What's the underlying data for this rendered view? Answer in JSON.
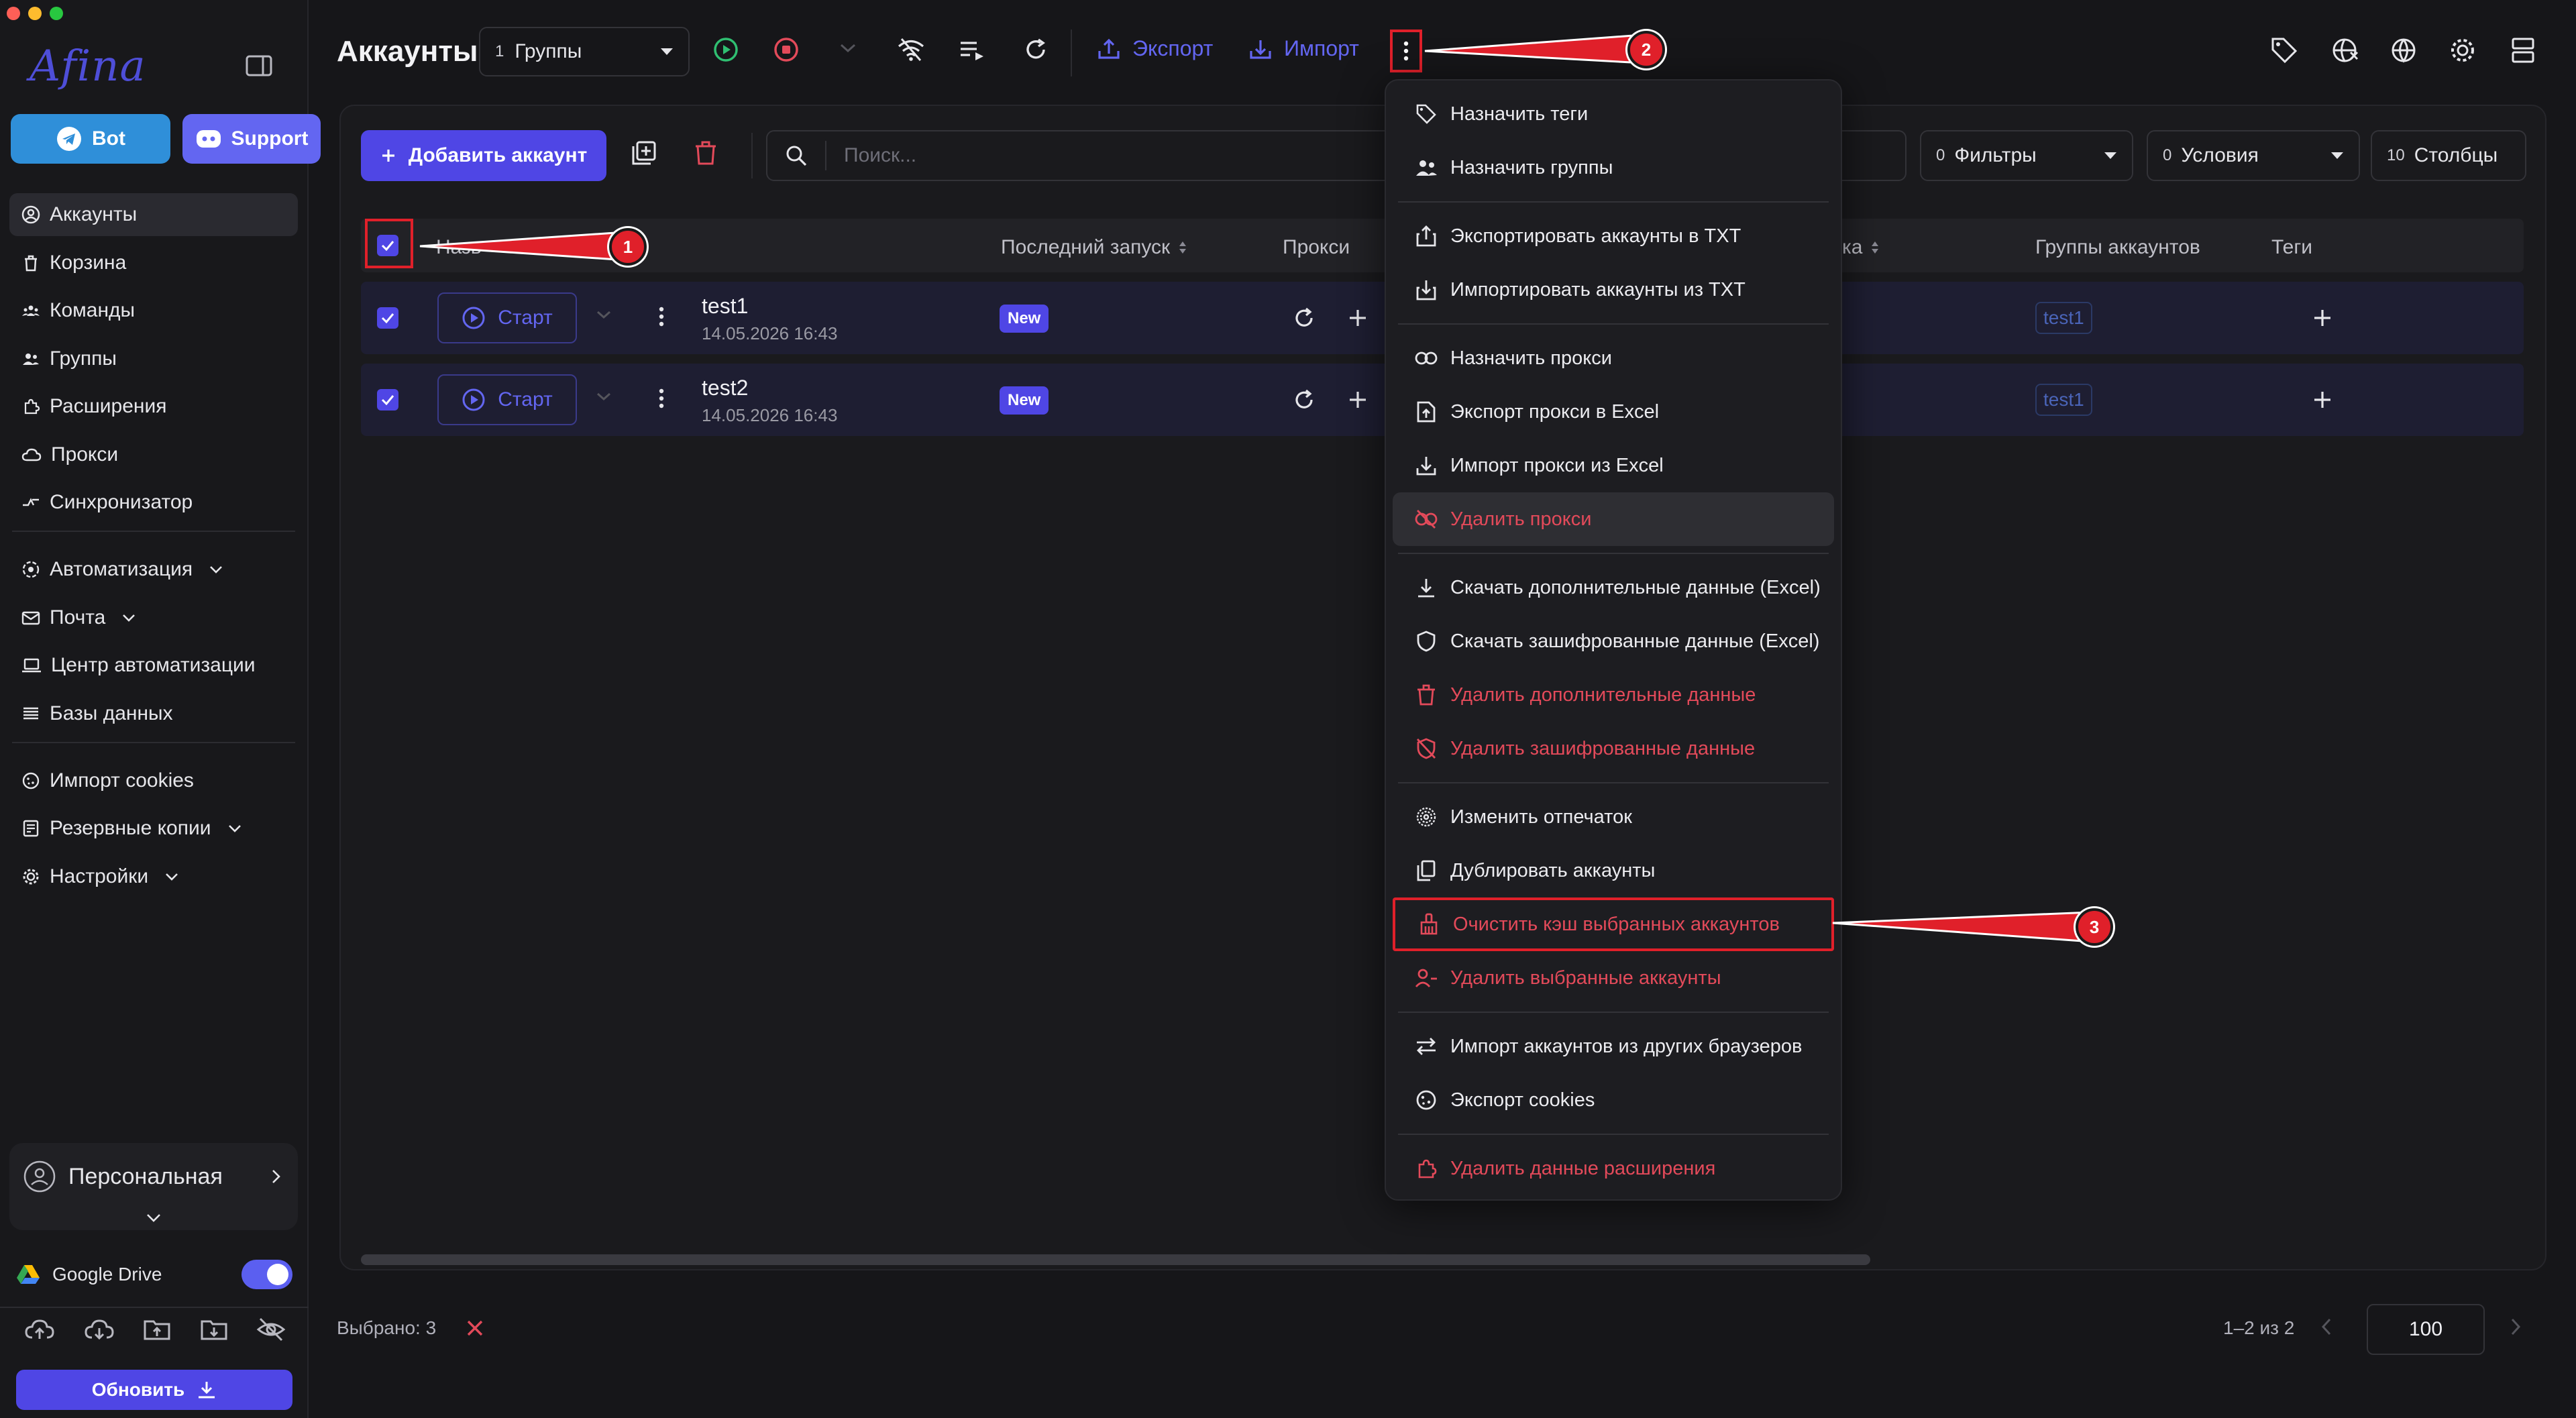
{
  "app": {
    "logo": "Afina"
  },
  "sidebar": {
    "bot_label": "Bot",
    "support_label": "Support",
    "items": [
      {
        "label": "Аккаунты",
        "icon": "user-circle-icon",
        "active": true
      },
      {
        "label": "Корзина",
        "icon": "trash-icon"
      },
      {
        "label": "Команды",
        "icon": "team-icon"
      },
      {
        "label": "Группы",
        "icon": "users-icon"
      },
      {
        "label": "Расширения",
        "icon": "puzzle-icon"
      },
      {
        "label": "Прокси",
        "icon": "cloud-icon"
      },
      {
        "label": "Синхронизатор",
        "icon": "sync-icon"
      }
    ],
    "items2": [
      {
        "label": "Автоматизация",
        "icon": "automation-icon",
        "chevron": true
      },
      {
        "label": "Почта",
        "icon": "mail-icon",
        "chevron": true
      },
      {
        "label": "Центр автоматизации",
        "icon": "laptop-icon"
      },
      {
        "label": "Базы данных",
        "icon": "list-icon"
      }
    ],
    "items3": [
      {
        "label": "Импорт cookies",
        "icon": "cookie-icon"
      },
      {
        "label": "Резервные копии",
        "icon": "backup-icon",
        "chevron": true
      },
      {
        "label": "Настройки",
        "icon": "gear-icon",
        "chevron": true
      }
    ],
    "workspace_label": "Персональная",
    "gdrive_label": "Google Drive",
    "update_label": "Обновить"
  },
  "toolbar": {
    "title": "Аккаунты",
    "group_count": "1",
    "group_label": "Группы",
    "export_label": "Экспорт",
    "import_label": "Импорт"
  },
  "content": {
    "add_account_label": "Добавить аккаунт",
    "search_placeholder": "Поиск...",
    "filters_count": "0",
    "filters_label": "Фильтры",
    "conditions_count": "0",
    "conditions_label": "Условия",
    "columns_count": "10",
    "columns_label": "Столбцы"
  },
  "table": {
    "headers": {
      "name": "Назв",
      "last_launch": "Последний запуск",
      "proxy": "Прокси",
      "partial": "ка",
      "groups": "Группы аккаунтов",
      "tags": "Теги"
    },
    "rows": [
      {
        "start_label": "Старт",
        "name": "test1",
        "date": "14.05.2026 16:43",
        "status": "New",
        "group": "test1"
      },
      {
        "start_label": "Старт",
        "name": "test2",
        "date": "14.05.2026 16:43",
        "status": "New",
        "group": "test1"
      }
    ]
  },
  "footer": {
    "selected_label": "Выбрано: 3",
    "pagination": "1–2 из 2",
    "page_size": "100"
  },
  "menu": {
    "sections": [
      [
        {
          "label": "Назначить теги",
          "icon": "tag-icon"
        },
        {
          "label": "Назначить группы",
          "icon": "users-icon"
        }
      ],
      [
        {
          "label": "Экспортировать аккаунты в TXT",
          "icon": "export-icon"
        },
        {
          "label": "Импортировать аккаунты из TXT",
          "icon": "import-icon"
        }
      ],
      [
        {
          "label": "Назначить прокси",
          "icon": "link-icon"
        },
        {
          "label": "Экспорт прокси в Excel",
          "icon": "file-upload-icon"
        },
        {
          "label": "Импорт прокси из Excel",
          "icon": "download-icon"
        },
        {
          "label": "Удалить прокси",
          "icon": "unlink-icon",
          "danger": true,
          "hover": true
        }
      ],
      [
        {
          "label": "Скачать дополнительные данные (Excel)",
          "icon": "download-bar-icon"
        },
        {
          "label": "Скачать зашифрованные данные (Excel)",
          "icon": "shield-icon"
        },
        {
          "label": "Удалить дополнительные данные",
          "icon": "trash-icon",
          "danger": true
        },
        {
          "label": "Удалить зашифрованные данные",
          "icon": "shield-off-icon",
          "danger": true
        }
      ],
      [
        {
          "label": "Изменить отпечаток",
          "icon": "fingerprint-icon"
        },
        {
          "label": "Дублировать аккаунты",
          "icon": "copy-icon"
        },
        {
          "label": "Очистить кэш выбранных аккаунтов",
          "icon": "broom-icon",
          "danger": true,
          "outlined": true
        },
        {
          "label": "Удалить выбранные аккаунты",
          "icon": "user-remove-icon",
          "danger": true
        }
      ],
      [
        {
          "label": "Импорт аккаунтов из других браузеров",
          "icon": "swap-icon"
        },
        {
          "label": "Экспорт cookies",
          "icon": "cookie-icon"
        }
      ],
      [
        {
          "label": "Удалить данные расширения",
          "icon": "puzzle-icon",
          "danger": true
        }
      ]
    ]
  },
  "annotations": [
    "1",
    "2",
    "3"
  ],
  "colors": {
    "accent": "#4f46e5",
    "danger": "#e34a5a",
    "annotation_red": "#e0202a",
    "bot_blue": "#2f8fd9"
  }
}
